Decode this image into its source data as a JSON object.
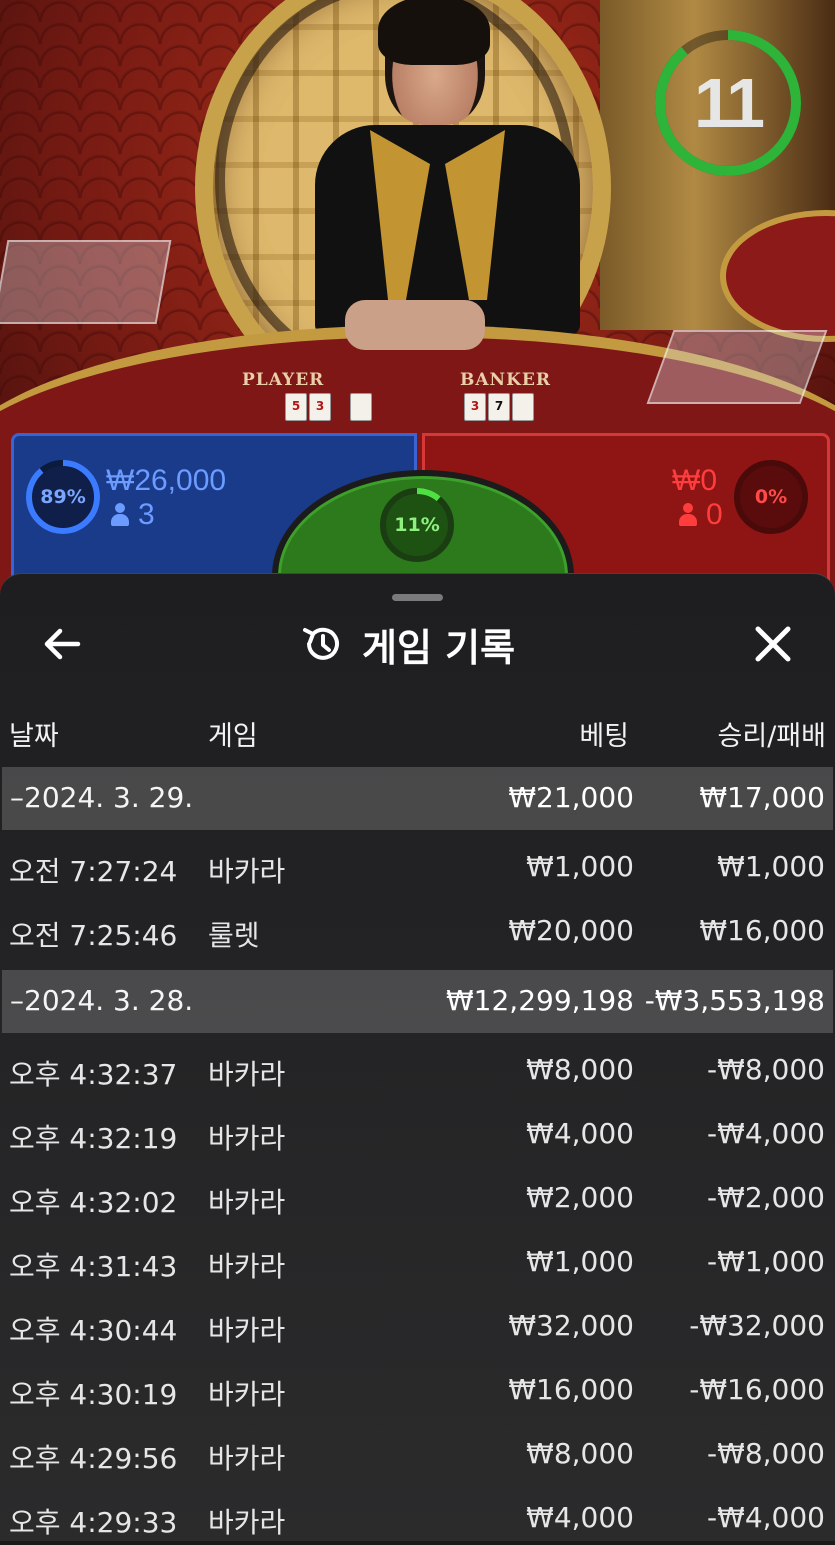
{
  "stream": {
    "countdown": "11",
    "table_labels": {
      "player": "PLAYER",
      "banker": "BANKER"
    },
    "player_cards": [
      "5",
      "3"
    ],
    "banker_cards": [
      "3",
      "7"
    ]
  },
  "bets": {
    "player": {
      "percent": "89%",
      "percent_value": 0.89,
      "amount": "₩26,000",
      "players": "3"
    },
    "tie": {
      "percent": "11%",
      "percent_value": 0.11
    },
    "banker": {
      "percent": "0%",
      "percent_value": 0.0,
      "amount": "₩0",
      "players": "0"
    },
    "colors": {
      "player": "#1a3a8a",
      "banker": "#8f1515",
      "tie": "#2c7a1c",
      "ring": "#33c03a"
    }
  },
  "history": {
    "title": "게임 기록",
    "icons": {
      "back": "arrow-left-icon",
      "history": "history-clock-icon",
      "close": "close-icon"
    },
    "columns": {
      "date": "날짜",
      "game": "게임",
      "bet": "베팅",
      "result": "승리/패배"
    },
    "groups": [
      {
        "date": "–2024. 3. 29.",
        "bet_total": "₩21,000",
        "result_total": "₩17,000",
        "rows": [
          {
            "time": "오전 7:27:24",
            "game": "바카라",
            "bet": "₩1,000",
            "result": "₩1,000"
          },
          {
            "time": "오전 7:25:46",
            "game": "룰렛",
            "bet": "₩20,000",
            "result": "₩16,000"
          }
        ]
      },
      {
        "date": "–2024. 3. 28.",
        "bet_total": "₩12,299,198",
        "result_total": "-₩3,553,198",
        "rows": [
          {
            "time": "오후 4:32:37",
            "game": "바카라",
            "bet": "₩8,000",
            "result": "-₩8,000"
          },
          {
            "time": "오후 4:32:19",
            "game": "바카라",
            "bet": "₩4,000",
            "result": "-₩4,000"
          },
          {
            "time": "오후 4:32:02",
            "game": "바카라",
            "bet": "₩2,000",
            "result": "-₩2,000"
          },
          {
            "time": "오후 4:31:43",
            "game": "바카라",
            "bet": "₩1,000",
            "result": "-₩1,000"
          },
          {
            "time": "오후 4:30:44",
            "game": "바카라",
            "bet": "₩32,000",
            "result": "-₩32,000"
          },
          {
            "time": "오후 4:30:19",
            "game": "바카라",
            "bet": "₩16,000",
            "result": "-₩16,000"
          },
          {
            "time": "오후 4:29:56",
            "game": "바카라",
            "bet": "₩8,000",
            "result": "-₩8,000"
          },
          {
            "time": "오후 4:29:33",
            "game": "바카라",
            "bet": "₩4,000",
            "result": "-₩4,000"
          }
        ]
      }
    ]
  }
}
